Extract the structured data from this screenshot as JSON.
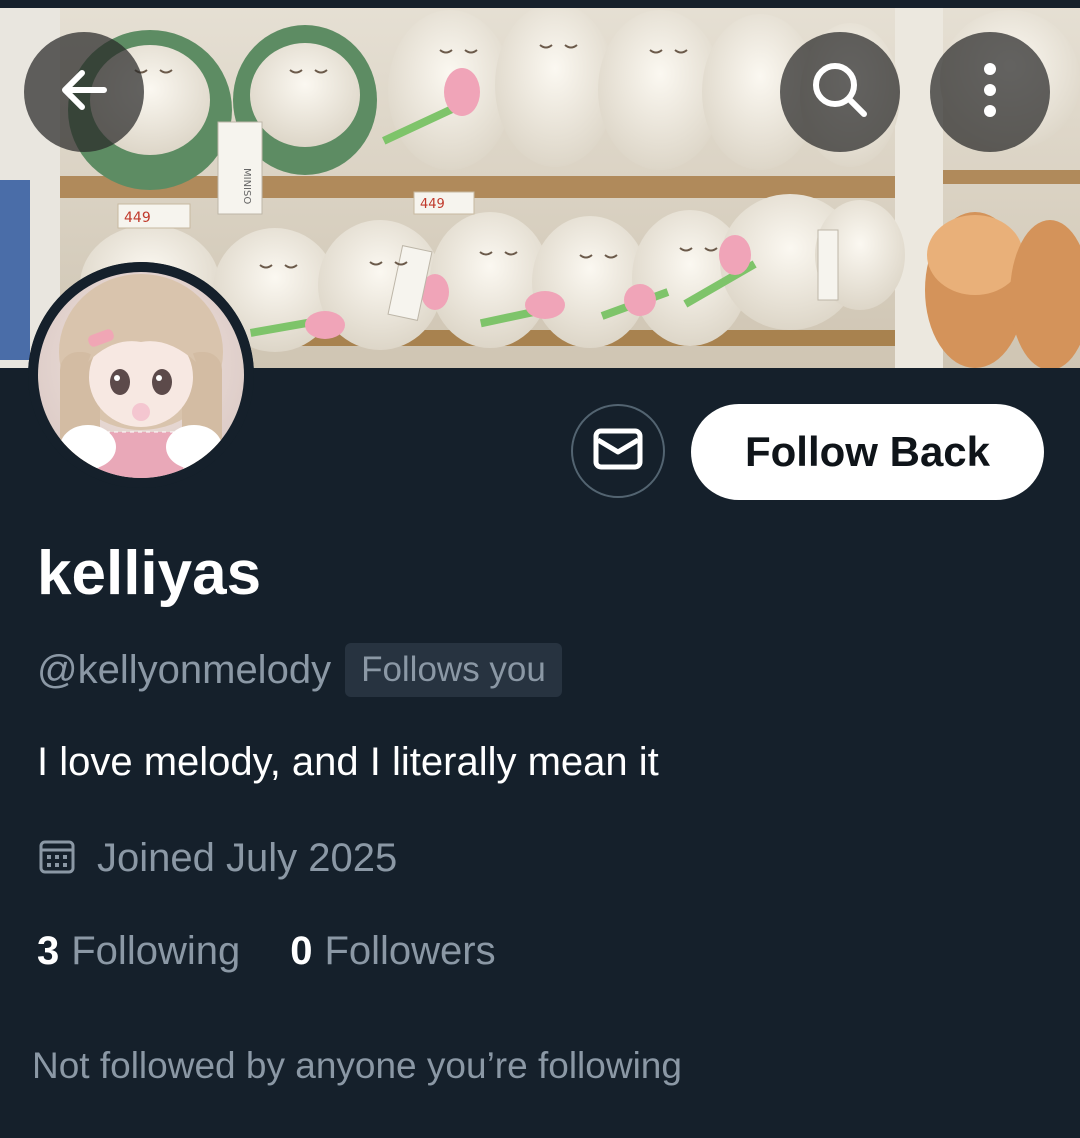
{
  "header": {
    "back_icon": "arrow-left-icon",
    "search_icon": "search-icon",
    "more_icon": "more-vertical-icon"
  },
  "banner": {
    "price_tags": [
      "449",
      "449"
    ],
    "brand_label": "MINISO"
  },
  "actions": {
    "message_icon": "envelope-icon",
    "follow_label": "Follow Back"
  },
  "profile": {
    "display_name": "kelliyas",
    "handle": "@kellyonmelody",
    "follows_you": "Follows you",
    "bio": "I love melody, and I literally mean it",
    "joined": "Joined July 2025",
    "calendar_icon": "calendar-icon"
  },
  "stats": {
    "following_count": "3",
    "following_label": "Following",
    "followers_count": "0",
    "followers_label": "Followers"
  },
  "mutuals_text": "Not followed by anyone you’re following",
  "colors": {
    "background": "#15202b",
    "secondary_text": "#8b98a5",
    "badge_bg": "#273340",
    "button_bg": "#ffffff"
  }
}
